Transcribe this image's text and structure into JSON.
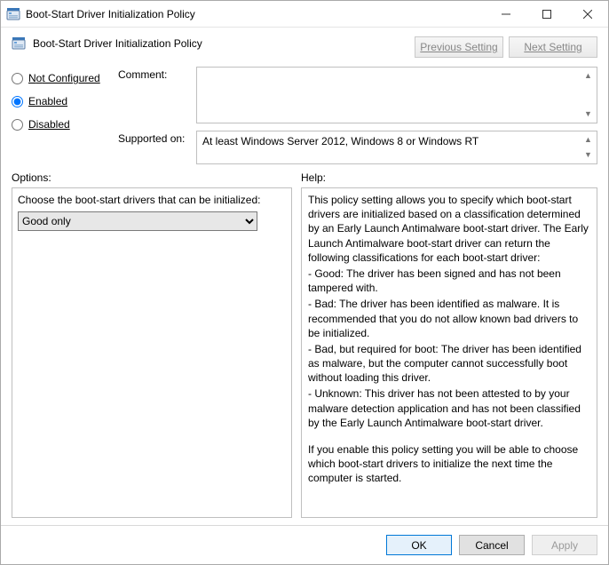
{
  "window": {
    "title": "Boot-Start Driver Initialization Policy"
  },
  "policy_name": "Boot-Start Driver Initialization Policy",
  "nav": {
    "previous": "Previous Setting",
    "next": "Next Setting"
  },
  "state": {
    "not_configured_label_pre": "N",
    "not_configured_label_u": "o",
    "not_configured_label_post": "t Configured",
    "enabled_label_u": "E",
    "enabled_label_post": "nabled",
    "disabled_label_u": "D",
    "disabled_label_post": "isabled",
    "selected": "enabled"
  },
  "comment": {
    "label": "Comment:",
    "value": ""
  },
  "supported": {
    "label": "Supported on:",
    "value": "At least Windows Server 2012, Windows 8 or Windows RT"
  },
  "sections": {
    "options": "Options:",
    "help": "Help:"
  },
  "options": {
    "prompt": "Choose the boot-start drivers that can be initialized:",
    "selected": "Good only",
    "items": [
      "Good only"
    ]
  },
  "help": {
    "p1": "This policy setting allows you to specify which boot-start drivers are initialized based on a classification determined by an Early Launch Antimalware boot-start driver. The Early Launch Antimalware boot-start driver can return the following classifications for each boot-start driver:",
    "b1": "-   Good: The driver has been signed and has not been tampered with.",
    "b2": "-   Bad: The driver has been identified as malware. It is recommended that you do not allow known bad drivers to be initialized.",
    "b3": "-   Bad, but required for boot: The driver has been identified as malware, but the computer cannot successfully boot without loading this driver.",
    "b4": "-   Unknown: This driver has not been attested to by your malware detection application and has not been classified by the Early Launch Antimalware boot-start driver.",
    "p2": "If you enable this policy setting you will be able to choose which boot-start drivers to initialize the next time the computer is started."
  },
  "buttons": {
    "ok": "OK",
    "cancel": "Cancel",
    "apply": "Apply"
  }
}
